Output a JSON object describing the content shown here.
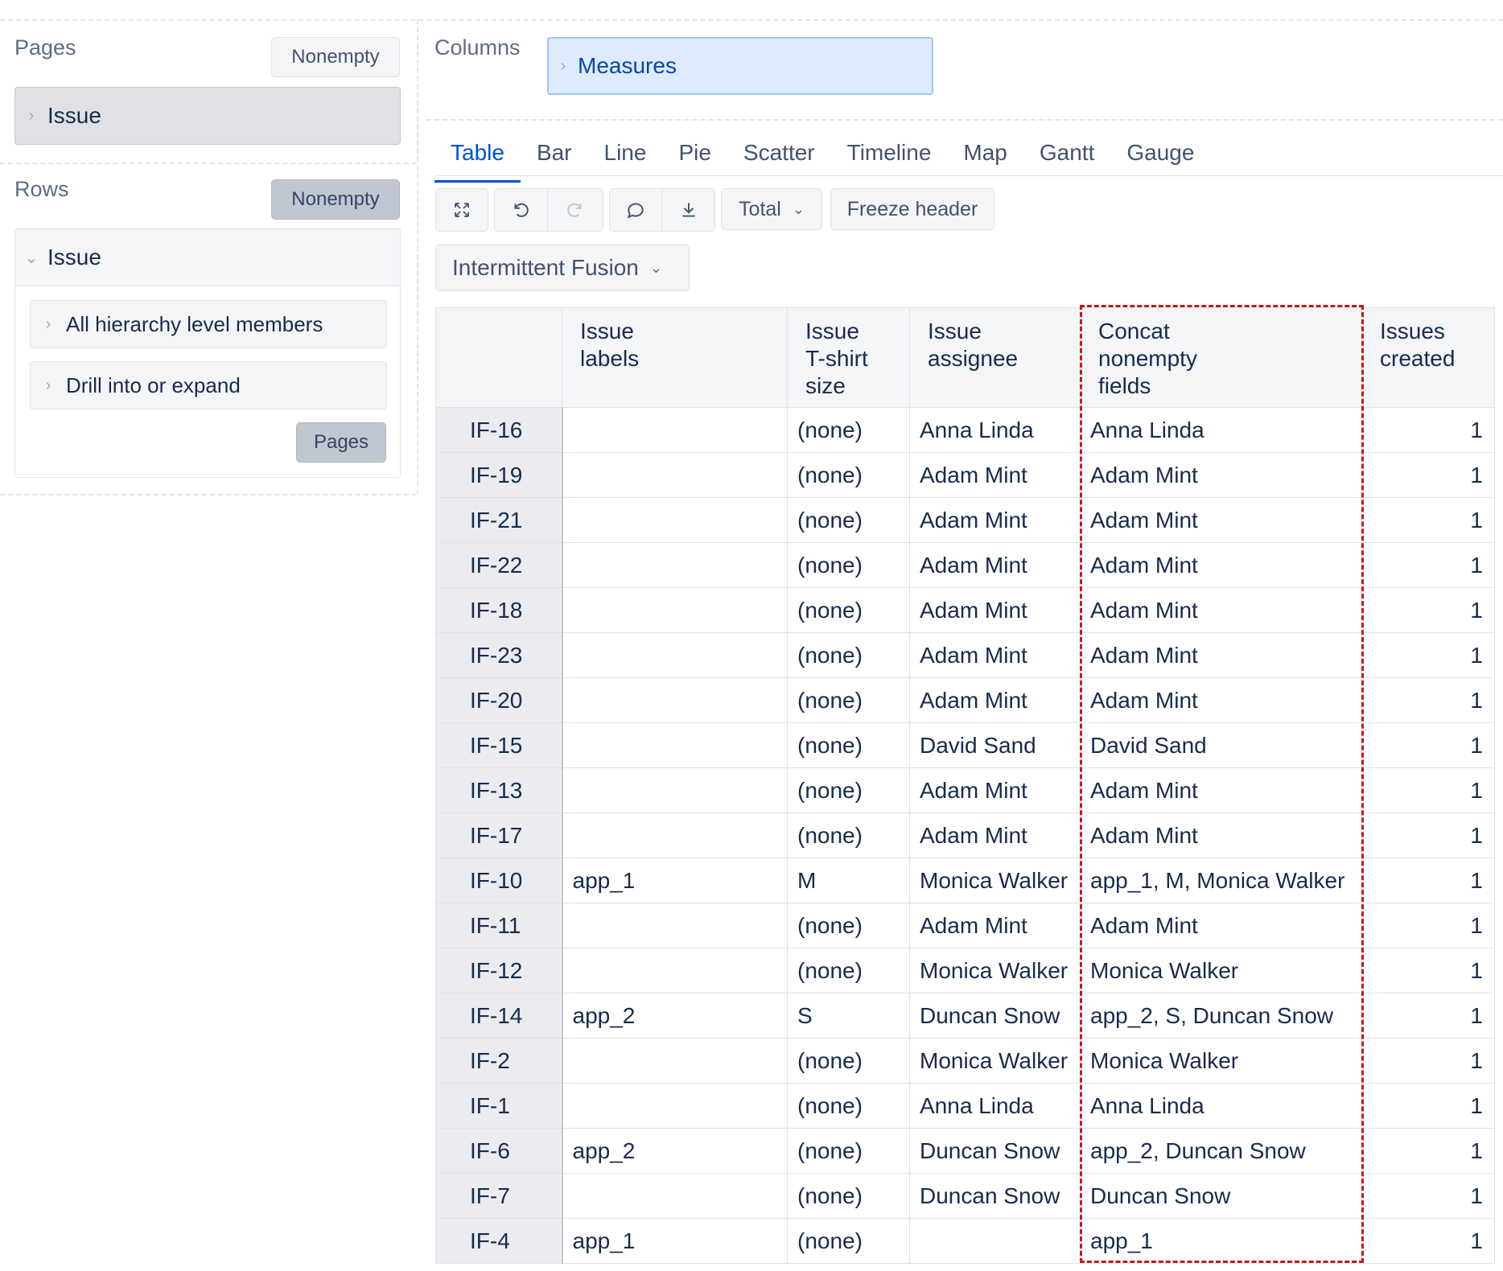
{
  "pages": {
    "title": "Pages",
    "nonempty_label": "Nonempty",
    "chip_label": "Issue"
  },
  "rows_section": {
    "title": "Rows",
    "nonempty_label": "Nonempty",
    "dimension_label": "Issue",
    "items": [
      {
        "label": "All hierarchy level members"
      },
      {
        "label": "Drill into or expand"
      }
    ],
    "pages_button": "Pages"
  },
  "columns": {
    "title": "Columns",
    "chip_label": "Measures"
  },
  "tabs": [
    {
      "label": "Table",
      "active": true
    },
    {
      "label": "Bar"
    },
    {
      "label": "Line"
    },
    {
      "label": "Pie"
    },
    {
      "label": "Scatter"
    },
    {
      "label": "Timeline"
    },
    {
      "label": "Map"
    },
    {
      "label": "Gantt"
    },
    {
      "label": "Gauge"
    }
  ],
  "toolbar": {
    "total_label": "Total",
    "freeze_header_label": "Freeze header",
    "icons": [
      "fullscreen-icon",
      "undo-icon",
      "redo-icon",
      "comment-icon",
      "download-icon"
    ]
  },
  "project_dropdown": "Intermittent Fusion",
  "table": {
    "headers": [
      "Issue\nlabels",
      "Issue\nT-shirt\nsize",
      "Issue\nassignee",
      "Concat\nnonempty\nfields",
      "Issues\ncreated"
    ],
    "rows": [
      {
        "key": "IF-16",
        "labels": "",
        "size": "(none)",
        "assignee": "Anna Linda",
        "concat": "Anna Linda",
        "created": "1"
      },
      {
        "key": "IF-19",
        "labels": "",
        "size": "(none)",
        "assignee": "Adam Mint",
        "concat": "Adam Mint",
        "created": "1"
      },
      {
        "key": "IF-21",
        "labels": "",
        "size": "(none)",
        "assignee": "Adam Mint",
        "concat": "Adam Mint",
        "created": "1"
      },
      {
        "key": "IF-22",
        "labels": "",
        "size": "(none)",
        "assignee": "Adam Mint",
        "concat": "Adam Mint",
        "created": "1"
      },
      {
        "key": "IF-18",
        "labels": "",
        "size": "(none)",
        "assignee": "Adam Mint",
        "concat": "Adam Mint",
        "created": "1"
      },
      {
        "key": "IF-23",
        "labels": "",
        "size": "(none)",
        "assignee": "Adam Mint",
        "concat": "Adam Mint",
        "created": "1"
      },
      {
        "key": "IF-20",
        "labels": "",
        "size": "(none)",
        "assignee": "Adam Mint",
        "concat": "Adam Mint",
        "created": "1"
      },
      {
        "key": "IF-15",
        "labels": "",
        "size": "(none)",
        "assignee": "David Sand",
        "concat": "David Sand",
        "created": "1"
      },
      {
        "key": "IF-13",
        "labels": "",
        "size": "(none)",
        "assignee": "Adam Mint",
        "concat": "Adam Mint",
        "created": "1"
      },
      {
        "key": "IF-17",
        "labels": "",
        "size": "(none)",
        "assignee": "Adam Mint",
        "concat": "Adam Mint",
        "created": "1"
      },
      {
        "key": "IF-10",
        "labels": "app_1",
        "size": "M",
        "assignee": "Monica Walker",
        "concat": "app_1, M, Monica Walker",
        "created": "1"
      },
      {
        "key": "IF-11",
        "labels": "",
        "size": "(none)",
        "assignee": "Adam Mint",
        "concat": "Adam Mint",
        "created": "1"
      },
      {
        "key": "IF-12",
        "labels": "",
        "size": "(none)",
        "assignee": "Monica Walker",
        "concat": "Monica Walker",
        "created": "1"
      },
      {
        "key": "IF-14",
        "labels": "app_2",
        "size": "S",
        "assignee": "Duncan Snow",
        "concat": "app_2, S, Duncan Snow",
        "created": "1"
      },
      {
        "key": "IF-2",
        "labels": "",
        "size": "(none)",
        "assignee": "Monica Walker",
        "concat": "Monica Walker",
        "created": "1"
      },
      {
        "key": "IF-1",
        "labels": "",
        "size": "(none)",
        "assignee": "Anna Linda",
        "concat": "Anna Linda",
        "created": "1"
      },
      {
        "key": "IF-6",
        "labels": "app_2",
        "size": "(none)",
        "assignee": "Duncan Snow",
        "concat": "app_2, Duncan Snow",
        "created": "1"
      },
      {
        "key": "IF-7",
        "labels": "",
        "size": "(none)",
        "assignee": "Duncan Snow",
        "concat": "Duncan Snow",
        "created": "1"
      },
      {
        "key": "IF-4",
        "labels": "app_1",
        "size": "(none)",
        "assignee": "",
        "concat": "app_1",
        "created": "1"
      }
    ]
  },
  "colors": {
    "accent": "#0052cc",
    "highlight_border": "#c41a1a",
    "measures_chip_bg": "#deebff"
  }
}
